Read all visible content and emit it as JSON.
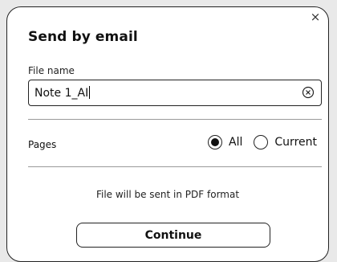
{
  "dialog": {
    "title": "Send by email",
    "close_glyph": "×"
  },
  "file": {
    "label": "File name",
    "value": "Note 1_AI",
    "clear_icon": "circle-x-icon"
  },
  "pages": {
    "label": "Pages",
    "options": [
      {
        "label": "All",
        "selected": true
      },
      {
        "label": "Current",
        "selected": false
      }
    ]
  },
  "info": {
    "text": "File will be sent in PDF format"
  },
  "actions": {
    "continue_label": "Continue"
  }
}
